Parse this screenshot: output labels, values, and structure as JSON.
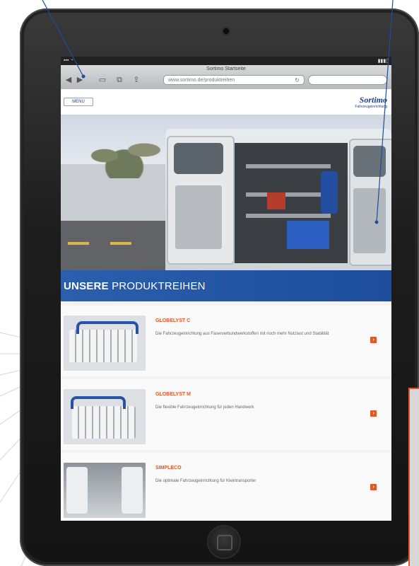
{
  "browser": {
    "page_title": "Sortimo Startseite",
    "address": "www.sortimo.de/produktreihen",
    "reload_icon": "reload-icon"
  },
  "site": {
    "menu_label": "MENU",
    "logo": "Sortimo",
    "logo_sub": "Fahrzeugeinrichtung"
  },
  "banner": {
    "part1": "UNSERE ",
    "part2": "PRODUKTREIHEN"
  },
  "products": [
    {
      "title": "GLOBELYST C",
      "description": "Die Fahrzeugeinrichtung aus Faserverbundwerkstoffen mit noch mehr Nutzlast und Stabilität",
      "button": "›"
    },
    {
      "title": "GLOBELYST M",
      "description": "Die flexible Fahrzeugeinrichtung für jeden Handwerk",
      "button": "›"
    },
    {
      "title": "SIMPLECO",
      "description": "Die optimale Fahrzeugeinrichtung für Kleintransporter",
      "button": "›"
    }
  ],
  "colors": {
    "accent": "#e2562a",
    "brand_blue": "#1d4d9c"
  }
}
